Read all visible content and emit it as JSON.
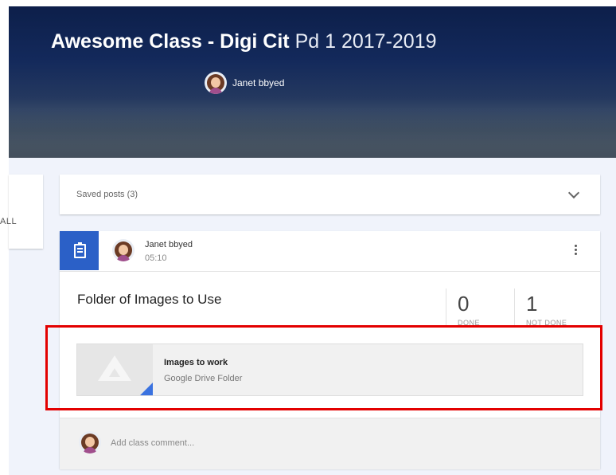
{
  "header": {
    "title_bold": "Awesome Class - Digi Cit",
    "title_light": "Pd 1 2017-2019",
    "teacher_name": "Janet bbyed"
  },
  "sidebar": {
    "all_label": "ALL"
  },
  "saved_posts": {
    "label": "Saved posts (3)"
  },
  "post": {
    "author": "Janet bbyed",
    "time": "05:10",
    "title": "Folder of Images to Use",
    "stats": [
      {
        "value": "0",
        "label": "DONE"
      },
      {
        "value": "1",
        "label": "NOT DONE"
      }
    ],
    "attachment": {
      "title": "Images to work",
      "subtitle": "Google Drive Folder"
    },
    "comment_placeholder": "Add class comment..."
  },
  "colors": {
    "accent": "#2b60c7",
    "highlight": "#e30000",
    "content_bg": "#f0f3fb"
  },
  "icons": [
    "assignment-icon",
    "avatar",
    "more-vert-icon",
    "chevron-down-icon",
    "google-drive-icon"
  ]
}
